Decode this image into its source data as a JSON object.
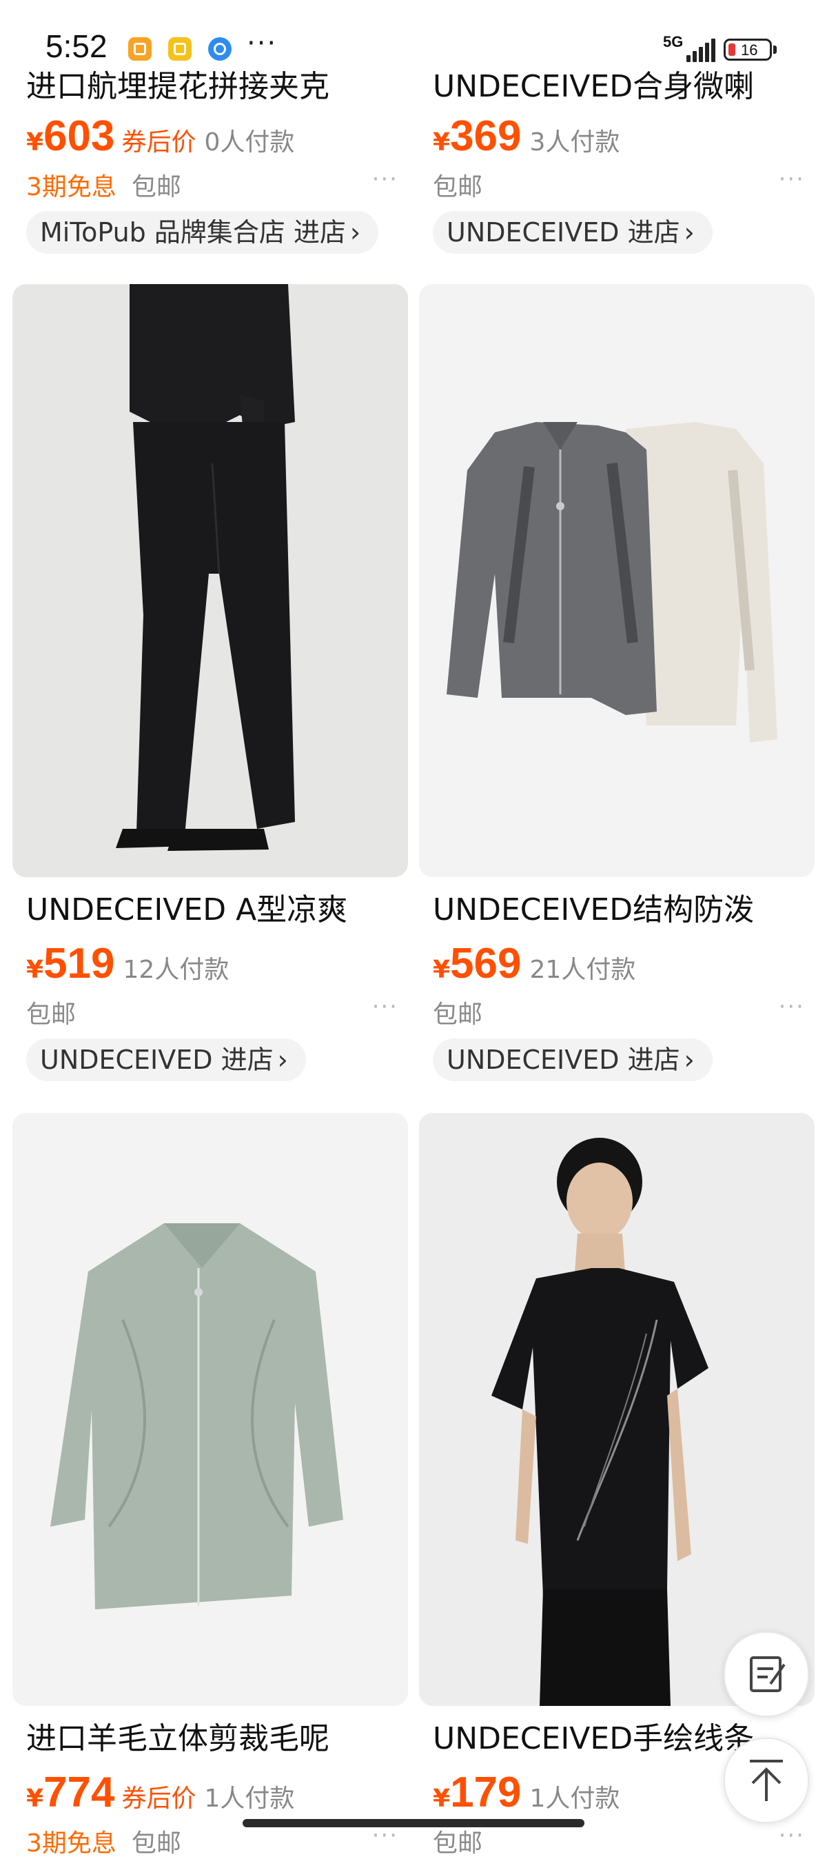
{
  "status_bar": {
    "time": "5:52",
    "more": "···",
    "network": "5G",
    "battery": "16",
    "icons": [
      "app-notification-icon",
      "chat-app-icon",
      "browser-app-icon",
      "signal-icon",
      "battery-icon"
    ]
  },
  "colors": {
    "price": "#ff5000",
    "free_interest": "#ff6a00",
    "muted": "#888888",
    "pill_bg": "#f3f3f3"
  },
  "cards": [
    {
      "title": "进口航埋提花拼接夹克",
      "price_symbol": "¥",
      "price": "603",
      "coupon_label": "券后价",
      "sales": "0人付款",
      "free_interest": "3期免息",
      "shipping": "包邮",
      "more": "···",
      "shop": "MiToPub 品牌集合店 进店",
      "arrow": "›"
    },
    {
      "title": "UNDECEIVED合身微喇",
      "price_symbol": "¥",
      "price": "369",
      "sales": "3人付款",
      "shipping": "包邮",
      "more": "···",
      "shop": "UNDECEIVED 进店",
      "arrow": "›"
    },
    {
      "title": "UNDECEIVED A型凉爽",
      "price_symbol": "¥",
      "price": "519",
      "sales": "12人付款",
      "shipping": "包邮",
      "more": "···",
      "shop": "UNDECEIVED 进店",
      "arrow": "›"
    },
    {
      "title": "UNDECEIVED结构防泼",
      "price_symbol": "¥",
      "price": "569",
      "sales": "21人付款",
      "shipping": "包邮",
      "more": "···",
      "shop": "UNDECEIVED 进店",
      "arrow": "›"
    },
    {
      "title": "进口羊毛立体剪裁毛呢",
      "price_symbol": "¥",
      "price": "774",
      "coupon_label": "券后价",
      "sales": "1人付款",
      "free_interest": "3期免息",
      "shipping": "包邮",
      "more": "···"
    },
    {
      "title": "UNDECEIVED手绘线条",
      "price_symbol": "¥",
      "price": "179",
      "sales": "1人付款",
      "shipping": "包邮",
      "more": "···"
    }
  ]
}
